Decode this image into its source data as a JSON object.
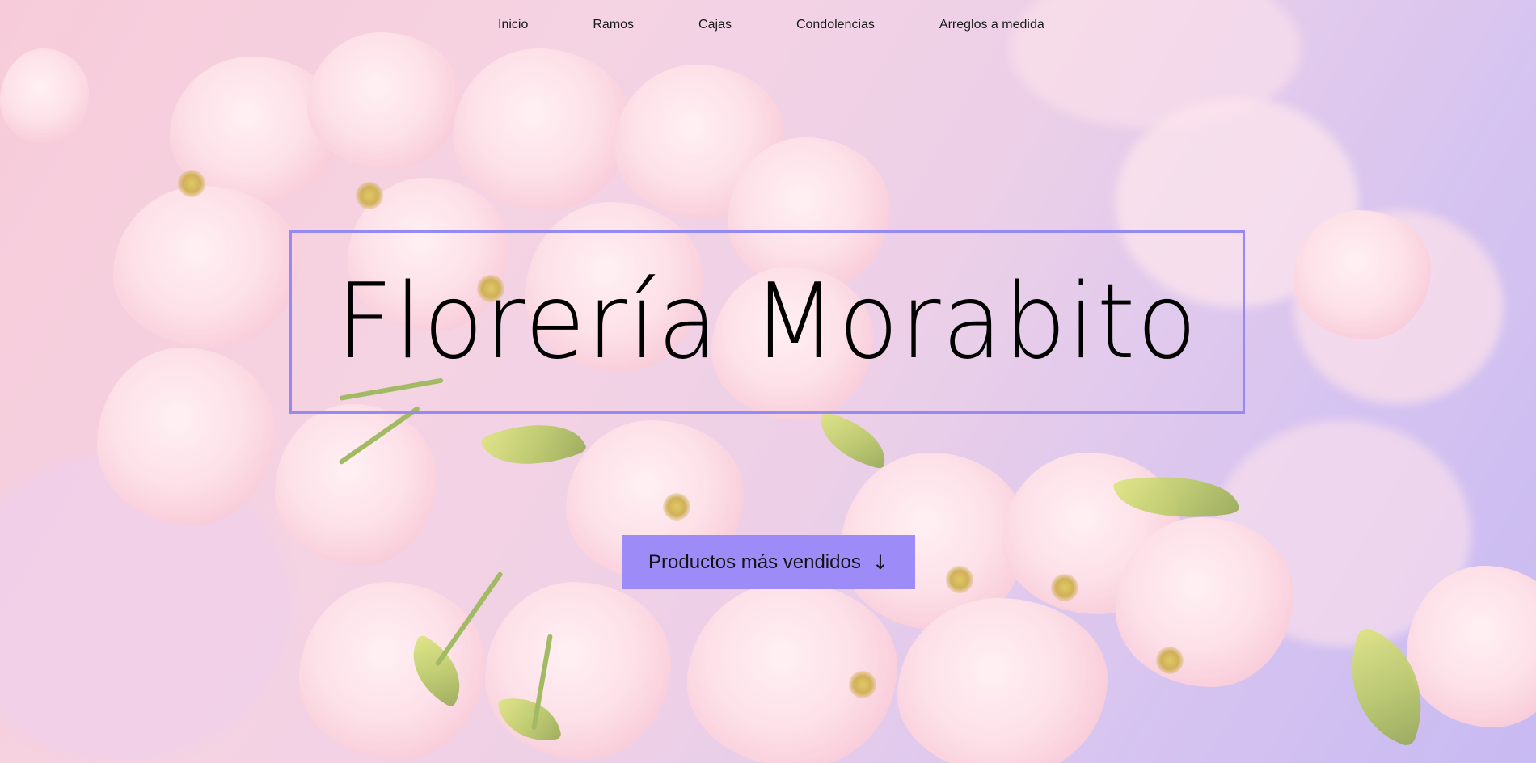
{
  "nav": {
    "items": [
      {
        "label": "Inicio"
      },
      {
        "label": "Ramos"
      },
      {
        "label": "Cajas"
      },
      {
        "label": "Condolencias"
      },
      {
        "label": "Arreglos a medida"
      }
    ]
  },
  "hero": {
    "title": "Florería Morabito",
    "cta_label": "Productos más vendidos",
    "cta_icon": "arrow-down-icon",
    "cta_arrow": "↓"
  },
  "colors": {
    "accent": "#9d8cf7",
    "frame": "#958af2"
  }
}
